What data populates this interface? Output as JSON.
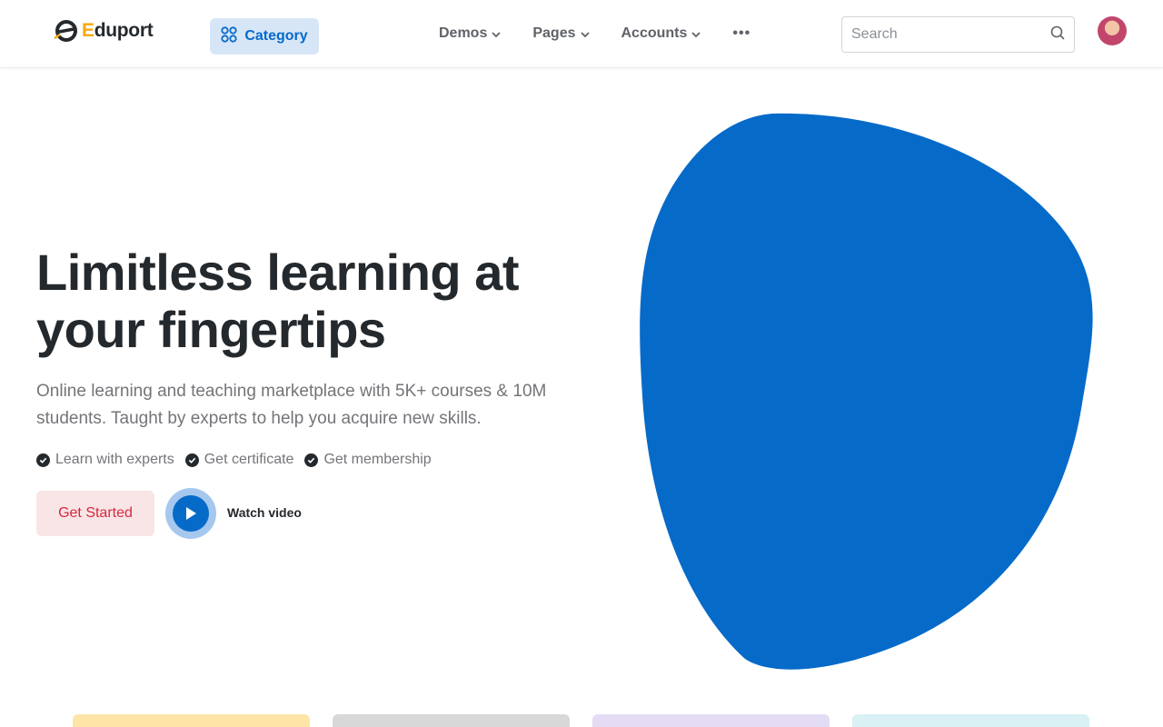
{
  "header": {
    "logo_initial": "E",
    "logo_rest": "duport",
    "category_label": "Category",
    "nav": [
      {
        "label": "Demos"
      },
      {
        "label": "Pages"
      },
      {
        "label": "Accounts"
      }
    ],
    "more_label": "•••",
    "search_placeholder": "Search"
  },
  "hero": {
    "title_line1": "Limitless learning at",
    "title_line2_prefix": "your ",
    "title_line2_highlight": "fingertips",
    "subtitle": "Online learning and teaching marketplace with 5K+ courses & 10M students. Taught by experts to help you acquire new skills.",
    "features": [
      {
        "label": "Learn with experts"
      },
      {
        "label": "Get certificate"
      },
      {
        "label": "Get membership"
      }
    ],
    "cta_label": "Get Started",
    "video_label": "Watch video"
  },
  "colors": {
    "primary": "#066ac9",
    "danger": "#d6293e",
    "highlight": "#fde2bd",
    "card_colors": [
      "#fde5a8",
      "#d8d8d8",
      "#e4dcf5",
      "#d9f1f4"
    ]
  },
  "icons": {
    "logo": "eduport-logo-icon",
    "category": "grid-icon",
    "chevron": "chevron-down-icon",
    "search": "search-icon",
    "check": "check-badge-icon",
    "play": "play-icon"
  }
}
